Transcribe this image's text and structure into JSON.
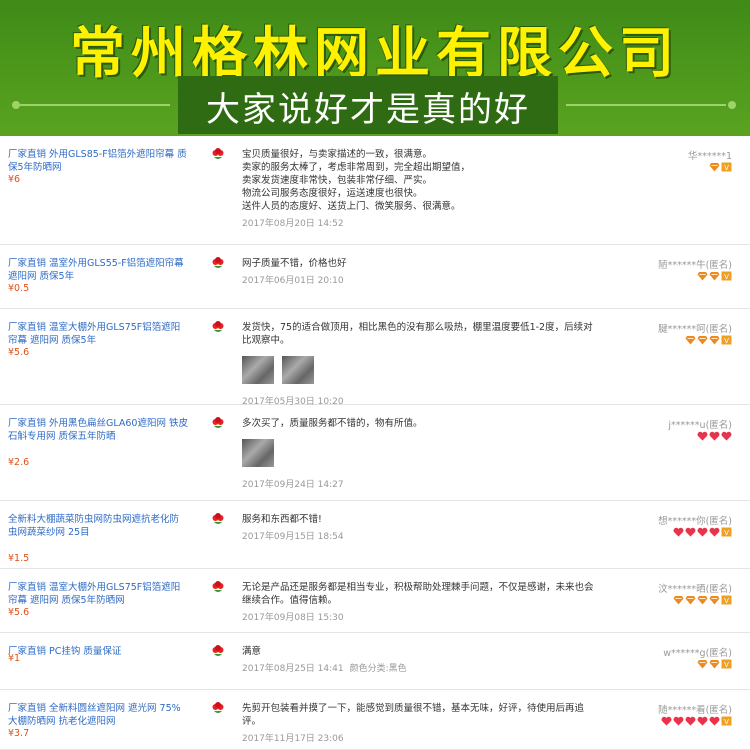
{
  "banner": {
    "company": "常州格林网业有限公司",
    "slogan": "大家说好才是真的好",
    "colors": {
      "bg": "#4f9a1c",
      "title": "#fff200",
      "slogan_bg": "#2f6b12"
    }
  },
  "reviews": [
    {
      "title": "厂家直销 外用GLS85-F铝箔外遮阳帘幕 质保5年防晒网",
      "price": "¥6",
      "comment": "宝贝质量很好，与卖家描述的一致，很满意。\n卖家的服务太棒了，考虑非常周到，完全超出期望值，\n卖家发货速度非常快，包装非常仔细、严实。\n物流公司服务态度很好，运送速度也很快。\n送件人员的态度好、送货上门、微笑服务、很满意。",
      "date": "2017年08月20日 14:52",
      "user": "华******1",
      "badges": [
        "diamond",
        "vip"
      ]
    },
    {
      "title": "厂家直销 温室外用GLS55-F铝箔遮阳帘幕 遮阳网 质保5年",
      "price": "¥0.5",
      "comment": "网子质量不错，价格也好",
      "date": "2017年06月01日 20:10",
      "user": "陋******牛(匿名)",
      "badges": [
        "diamond",
        "diamond",
        "vip"
      ]
    },
    {
      "title": "厂家直销 温室大棚外用GLS75F铝箔遮阳帘幕 遮阳网 质保5年",
      "price": "¥5.6",
      "comment": "发货快，75的适合做顶用，相比黑色的没有那么吸热，棚里温度要低1-2度，后续对\n比观察中。",
      "date": "2017年05月30日 10:20",
      "user": "腱******呵(匿名)",
      "badges": [
        "diamond",
        "diamond",
        "diamond",
        "vip"
      ],
      "photos": 2
    },
    {
      "title": "厂家直销 外用黑色扁丝GLA60遮阳网 铁皮石斛专用网 质保五年防晒",
      "price": "¥2.6",
      "comment": "多次买了，质量服务都不错的，物有所值。",
      "date": "2017年09月24日 14:27",
      "user": "j******u(匿名)",
      "badges": [
        "heart",
        "heart",
        "heart"
      ],
      "photos": 1
    },
    {
      "title": "全新料大棚蔬菜防虫网防虫网遮抗老化防虫网蔬菜纱网 25目",
      "price": "¥1.5",
      "comment": "服务和东西都不错!",
      "date": "2017年09月15日 18:54",
      "user": "想******你(匿名)",
      "badges": [
        "heart",
        "heart",
        "heart",
        "heart",
        "vip"
      ]
    },
    {
      "title": "厂家直销 温室大棚外用GLS75F铝箔遮阳帘幕 遮阳网 质保5年防晒网",
      "price": "¥5.6",
      "comment": "无论是产品还是服务都是相当专业，积极帮助处理棘手问题，不仅是感谢，未来也会\n继续合作。值得信赖。",
      "date": "2017年09月08日 15:30",
      "user": "汶******晒(匿名)",
      "badges": [
        "diamond",
        "diamond",
        "diamond",
        "diamond",
        "vip"
      ]
    },
    {
      "title": "厂家直销 PC挂钩 质量保证",
      "price": "¥1",
      "comment": "满意",
      "date": "2017年08月25日 14:41",
      "extra": "颜色分类:黑色",
      "user": "w******g(匿名)",
      "badges": [
        "diamond",
        "diamond",
        "vip"
      ]
    },
    {
      "title": "厂家直销 全新料圆丝遮阳网 遮光网 75%大棚防晒网 抗老化遮阳网",
      "price": "¥3.7",
      "comment": "先剪开包装看并摸了一下，能感觉到质量很不错，基本无味，好评，待使用后再追\n评。",
      "date": "2017年11月17日 23:06",
      "user": "随******看(匿名)",
      "badges": [
        "heart",
        "heart",
        "heart",
        "heart",
        "heart",
        "vip"
      ]
    }
  ]
}
